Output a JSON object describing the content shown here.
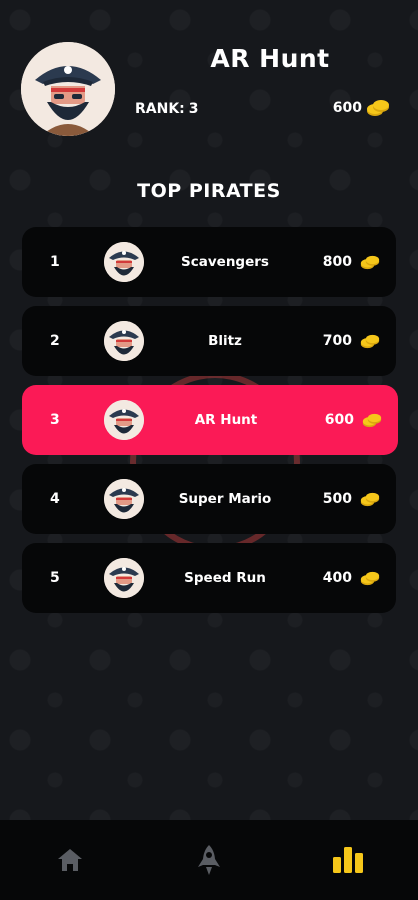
{
  "player": {
    "name": "AR Hunt",
    "rank_label": "RANK:",
    "rank_value": "3",
    "score": "600"
  },
  "leaderboard": {
    "title": "TOP PIRATES",
    "rows": [
      {
        "rank": "1",
        "name": "Scavengers",
        "score": "800",
        "active": false
      },
      {
        "rank": "2",
        "name": "Blitz",
        "score": "700",
        "active": false
      },
      {
        "rank": "3",
        "name": "AR Hunt",
        "score": "600",
        "active": true
      },
      {
        "rank": "4",
        "name": "Super Mario",
        "score": "500",
        "active": false
      },
      {
        "rank": "5",
        "name": "Speed Run",
        "score": "400",
        "active": false
      }
    ]
  },
  "nav": {
    "items": [
      {
        "icon": "home-icon",
        "active": false
      },
      {
        "icon": "rocket-icon",
        "active": false
      },
      {
        "icon": "leaderboard-icon",
        "active": true
      }
    ]
  },
  "colors": {
    "accent": "#fb1a56",
    "gold": "#f6c71a",
    "nav_inactive": "#5a5d63"
  }
}
